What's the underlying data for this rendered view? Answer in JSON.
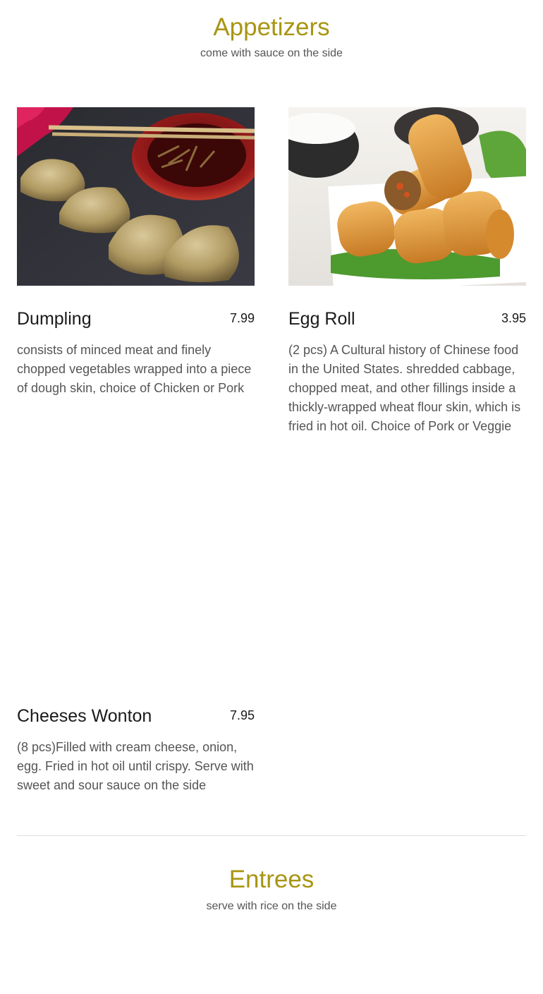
{
  "appetizers": {
    "title": "Appetizers",
    "subtitle": "come with sauce on the side",
    "items": [
      {
        "name": "Dumpling",
        "price": "7.99",
        "description": "consists of minced meat and finely chopped vegetables wrapped into a piece of dough skin, choice of Chicken or Pork",
        "image": "dumpling-photo"
      },
      {
        "name": "Egg Roll",
        "price": "3.95",
        "description": "(2 pcs) A Cultural history of Chinese food in the United States. shredded cabbage, chopped meat, and other fillings inside a thickly-wrapped wheat flour skin, which is fried in hot oil. Choice of Pork or Veggie",
        "image": "egg-roll-photo"
      },
      {
        "name": "Cheeses Wonton",
        "price": "7.95",
        "description": "(8 pcs)Filled with cream cheese, onion, egg. Fried in hot oil until crispy. Serve with sweet and sour sauce on the side"
      }
    ]
  },
  "entrees": {
    "title": "Entrees",
    "subtitle": "serve with rice on the side"
  },
  "colors": {
    "section_title": "#a89512",
    "divider": "#dddddd"
  }
}
